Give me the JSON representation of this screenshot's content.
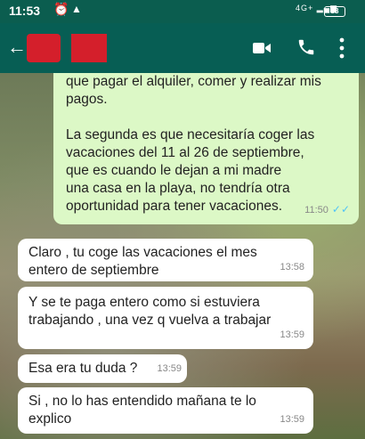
{
  "status": {
    "time": "11:53",
    "network": "4G+",
    "battery": "88"
  },
  "header": {
    "back_glyph": "←"
  },
  "messages": [
    {
      "direction": "out",
      "text": "que pagar el alquiler, comer y realizar mis\npagos.\n\nLa segunda es que necesitaría coger las\nvacaciones del 11 al 26 de septiembre,\nque es cuando le dejan a mi madre\nuna casa en la playa, no tendría otra\noportunidad para tener vacaciones.",
      "time": "11:50",
      "ticks": "✓✓"
    },
    {
      "direction": "in",
      "text": "Claro , tu coge las vacaciones  el mes\nentero de septiembre",
      "time": "13:58"
    },
    {
      "direction": "in",
      "text": "Y se te paga entero como si estuviera\ntrabajando  , una vez q vuelva a trabajar",
      "time": "13:59"
    },
    {
      "direction": "in",
      "text": "Esa era tu duda ?",
      "time": "13:59"
    },
    {
      "direction": "in",
      "text": "Si , no lo has entendido  mañana  te lo\nexplico",
      "time": "13:59"
    }
  ]
}
